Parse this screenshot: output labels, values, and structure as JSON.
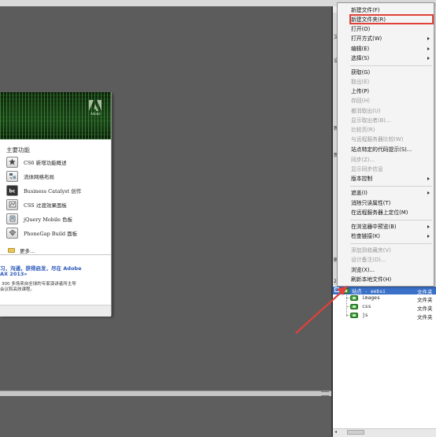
{
  "welcome": {
    "adobe_logo_text": "Adobe",
    "main_features_heading": "主要功能",
    "features": [
      {
        "label": "CS6 新增功能概述",
        "icon": "star-icon"
      },
      {
        "label": "流体网格布局",
        "icon": "fluid-grid-icon"
      },
      {
        "label": "Business Catalyst 创作",
        "icon": "business-catalyst-icon"
      },
      {
        "label": "CSS 过渡效果面板",
        "icon": "css-transitions-icon"
      },
      {
        "label": "jQuery Mobile 色板",
        "icon": "jquery-mobile-icon"
      },
      {
        "label": "PhoneGap Build 面板",
        "icon": "phonegap-icon"
      }
    ],
    "more_label": "更多...",
    "promo_line_1": "习，沟通，获得启发，尽在 Adobe",
    "promo_line_2": "AX 2013»",
    "promo_line_3": "300 多场来自全球的专家演讲者所主导",
    "promo_line_4": "会议和高效课程。"
  },
  "context_menu": {
    "items": [
      {
        "label": "新建文件(F)",
        "disabled": false,
        "submenu": false
      },
      {
        "label": "新建文件夹(R)",
        "disabled": false,
        "submenu": false,
        "highlighted": true
      },
      {
        "label": "打开(O)",
        "disabled": false,
        "submenu": false
      },
      {
        "label": "打开方式(W)",
        "disabled": false,
        "submenu": true
      },
      {
        "label": "编辑(E)",
        "disabled": false,
        "submenu": true
      },
      {
        "label": "选择(S)",
        "disabled": false,
        "submenu": true
      },
      {
        "label": "获取(G)",
        "disabled": false,
        "submenu": false
      },
      {
        "label": "取出(E)",
        "disabled": true,
        "submenu": false
      },
      {
        "label": "上传(P)",
        "disabled": false,
        "submenu": false
      },
      {
        "label": "存回(H)",
        "disabled": true,
        "submenu": false
      },
      {
        "label": "撤消取出(U)",
        "disabled": true,
        "submenu": false
      },
      {
        "label": "显示取出者(B)...",
        "disabled": true,
        "submenu": false
      },
      {
        "label": "比较页(R)",
        "disabled": true,
        "submenu": false
      },
      {
        "label": "与远程服务器比较(W)",
        "disabled": true,
        "submenu": false
      },
      {
        "label": "站点特定的代码提示(S)...",
        "disabled": false,
        "submenu": false
      },
      {
        "label": "同步(Z)...",
        "disabled": true,
        "submenu": false
      },
      {
        "label": "显示同步信息",
        "disabled": true,
        "submenu": false
      },
      {
        "label": "版本控制",
        "disabled": false,
        "submenu": true
      },
      {
        "label": "遮盖(I)",
        "disabled": false,
        "submenu": true
      },
      {
        "label": "消除只读属性(T)",
        "disabled": false,
        "submenu": false
      },
      {
        "label": "在远程服务器上定位(M)",
        "disabled": false,
        "submenu": false
      },
      {
        "label": "在浏览器中预览(B)",
        "disabled": false,
        "submenu": true
      },
      {
        "label": "检查链接(K)",
        "disabled": false,
        "submenu": true
      },
      {
        "label": "添加到收藏夹(V)",
        "disabled": true,
        "submenu": false
      },
      {
        "label": "设计备注(D)...",
        "disabled": true,
        "submenu": false
      },
      {
        "label": "浏览(X)...",
        "disabled": false,
        "submenu": false
      },
      {
        "label": "刷新本地文件(H)",
        "disabled": false,
        "submenu": false
      }
    ]
  },
  "files": {
    "site_name": "站点 - eebsi",
    "site_type": "文件夹",
    "children": [
      {
        "name": "images",
        "type": "文件夹"
      },
      {
        "name": "css",
        "type": "文件夹"
      },
      {
        "name": "js",
        "type": "文件夹"
      }
    ]
  },
  "panel_edge_marks": [
    "文",
    "设",
    "新",
    "新",
    "解",
    "2"
  ],
  "colors": {
    "highlight_box": "#e0413a",
    "selection": "#3a70c8",
    "folder": "#3f9e3a"
  }
}
